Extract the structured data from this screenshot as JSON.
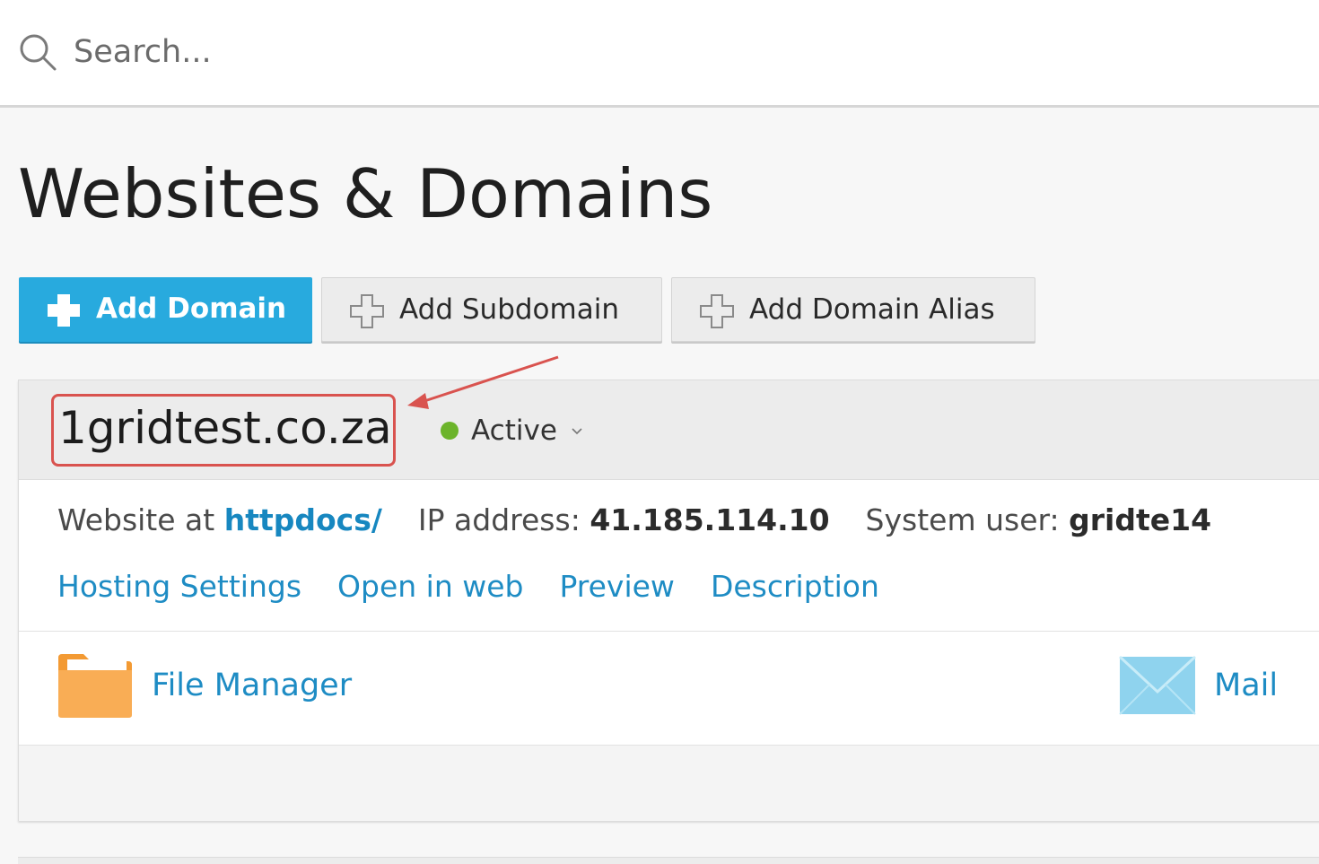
{
  "search": {
    "placeholder": "Search..."
  },
  "page": {
    "title": "Websites & Domains"
  },
  "toolbar": {
    "add_domain_label": "Add Domain",
    "add_subdomain_label": "Add Subdomain",
    "add_domain_alias_label": "Add Domain Alias"
  },
  "domain": {
    "name": "1gridtest.co.za",
    "status": "Active",
    "status_color": "#6cb42b",
    "website_at_label": "Website at",
    "website_path": "httpdocs/",
    "ip_label": "IP address:",
    "ip_value": "41.185.114.10",
    "system_user_label": "System user:",
    "system_user_value": "gridte14",
    "links": {
      "hosting_settings": "Hosting Settings",
      "open_in_web": "Open in web",
      "preview": "Preview",
      "description": "Description"
    },
    "tools": {
      "file_manager": "File Manager",
      "mail": "Mail"
    }
  },
  "colors": {
    "primary_button": "#28aade",
    "link": "#1e8cc4",
    "annotation": "#d9534f",
    "folder": "#f7a84a",
    "mail_icon": "#8fd3ee"
  },
  "icons": {
    "search": "search-icon",
    "add_domain": "plus-icon",
    "add_subdomain": "plus-outline-icon",
    "add_domain_alias": "plus-outline-icon",
    "status_chevron": "chevron-down-icon",
    "file_manager": "folder-icon",
    "mail": "envelope-icon"
  }
}
